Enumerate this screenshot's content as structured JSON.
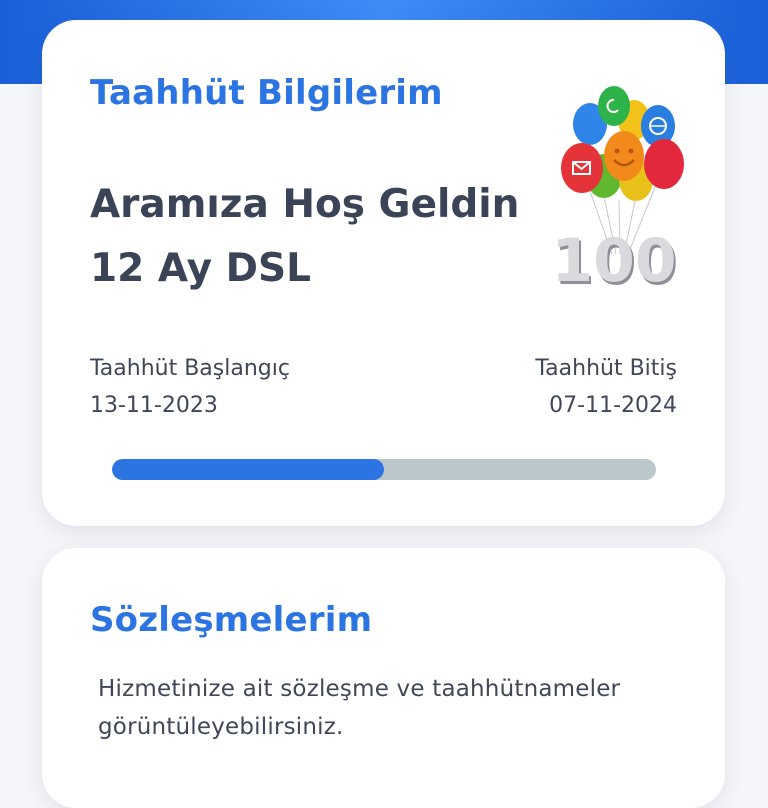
{
  "commitment": {
    "title": "Taahhüt Bilgilerim",
    "welcome": "Aramıza Hoş Geldin",
    "plan": "12 Ay DSL",
    "start_label": "Taahhüt Başlangıç",
    "start_date": "13-11-2023",
    "end_label": "Taahhüt Bitiş",
    "end_date": "07-11-2024",
    "progress": 0.5,
    "badge_number": "100"
  },
  "contracts": {
    "title": "Sözleşmelerim",
    "description": "Hizmetinize ait sözleşme ve taahhütnameler görüntüleyebilirsiniz."
  },
  "colors": {
    "accent": "#2b74e2",
    "progress_track": "#bcc7cc",
    "header_blue": "#1a5fd8"
  }
}
